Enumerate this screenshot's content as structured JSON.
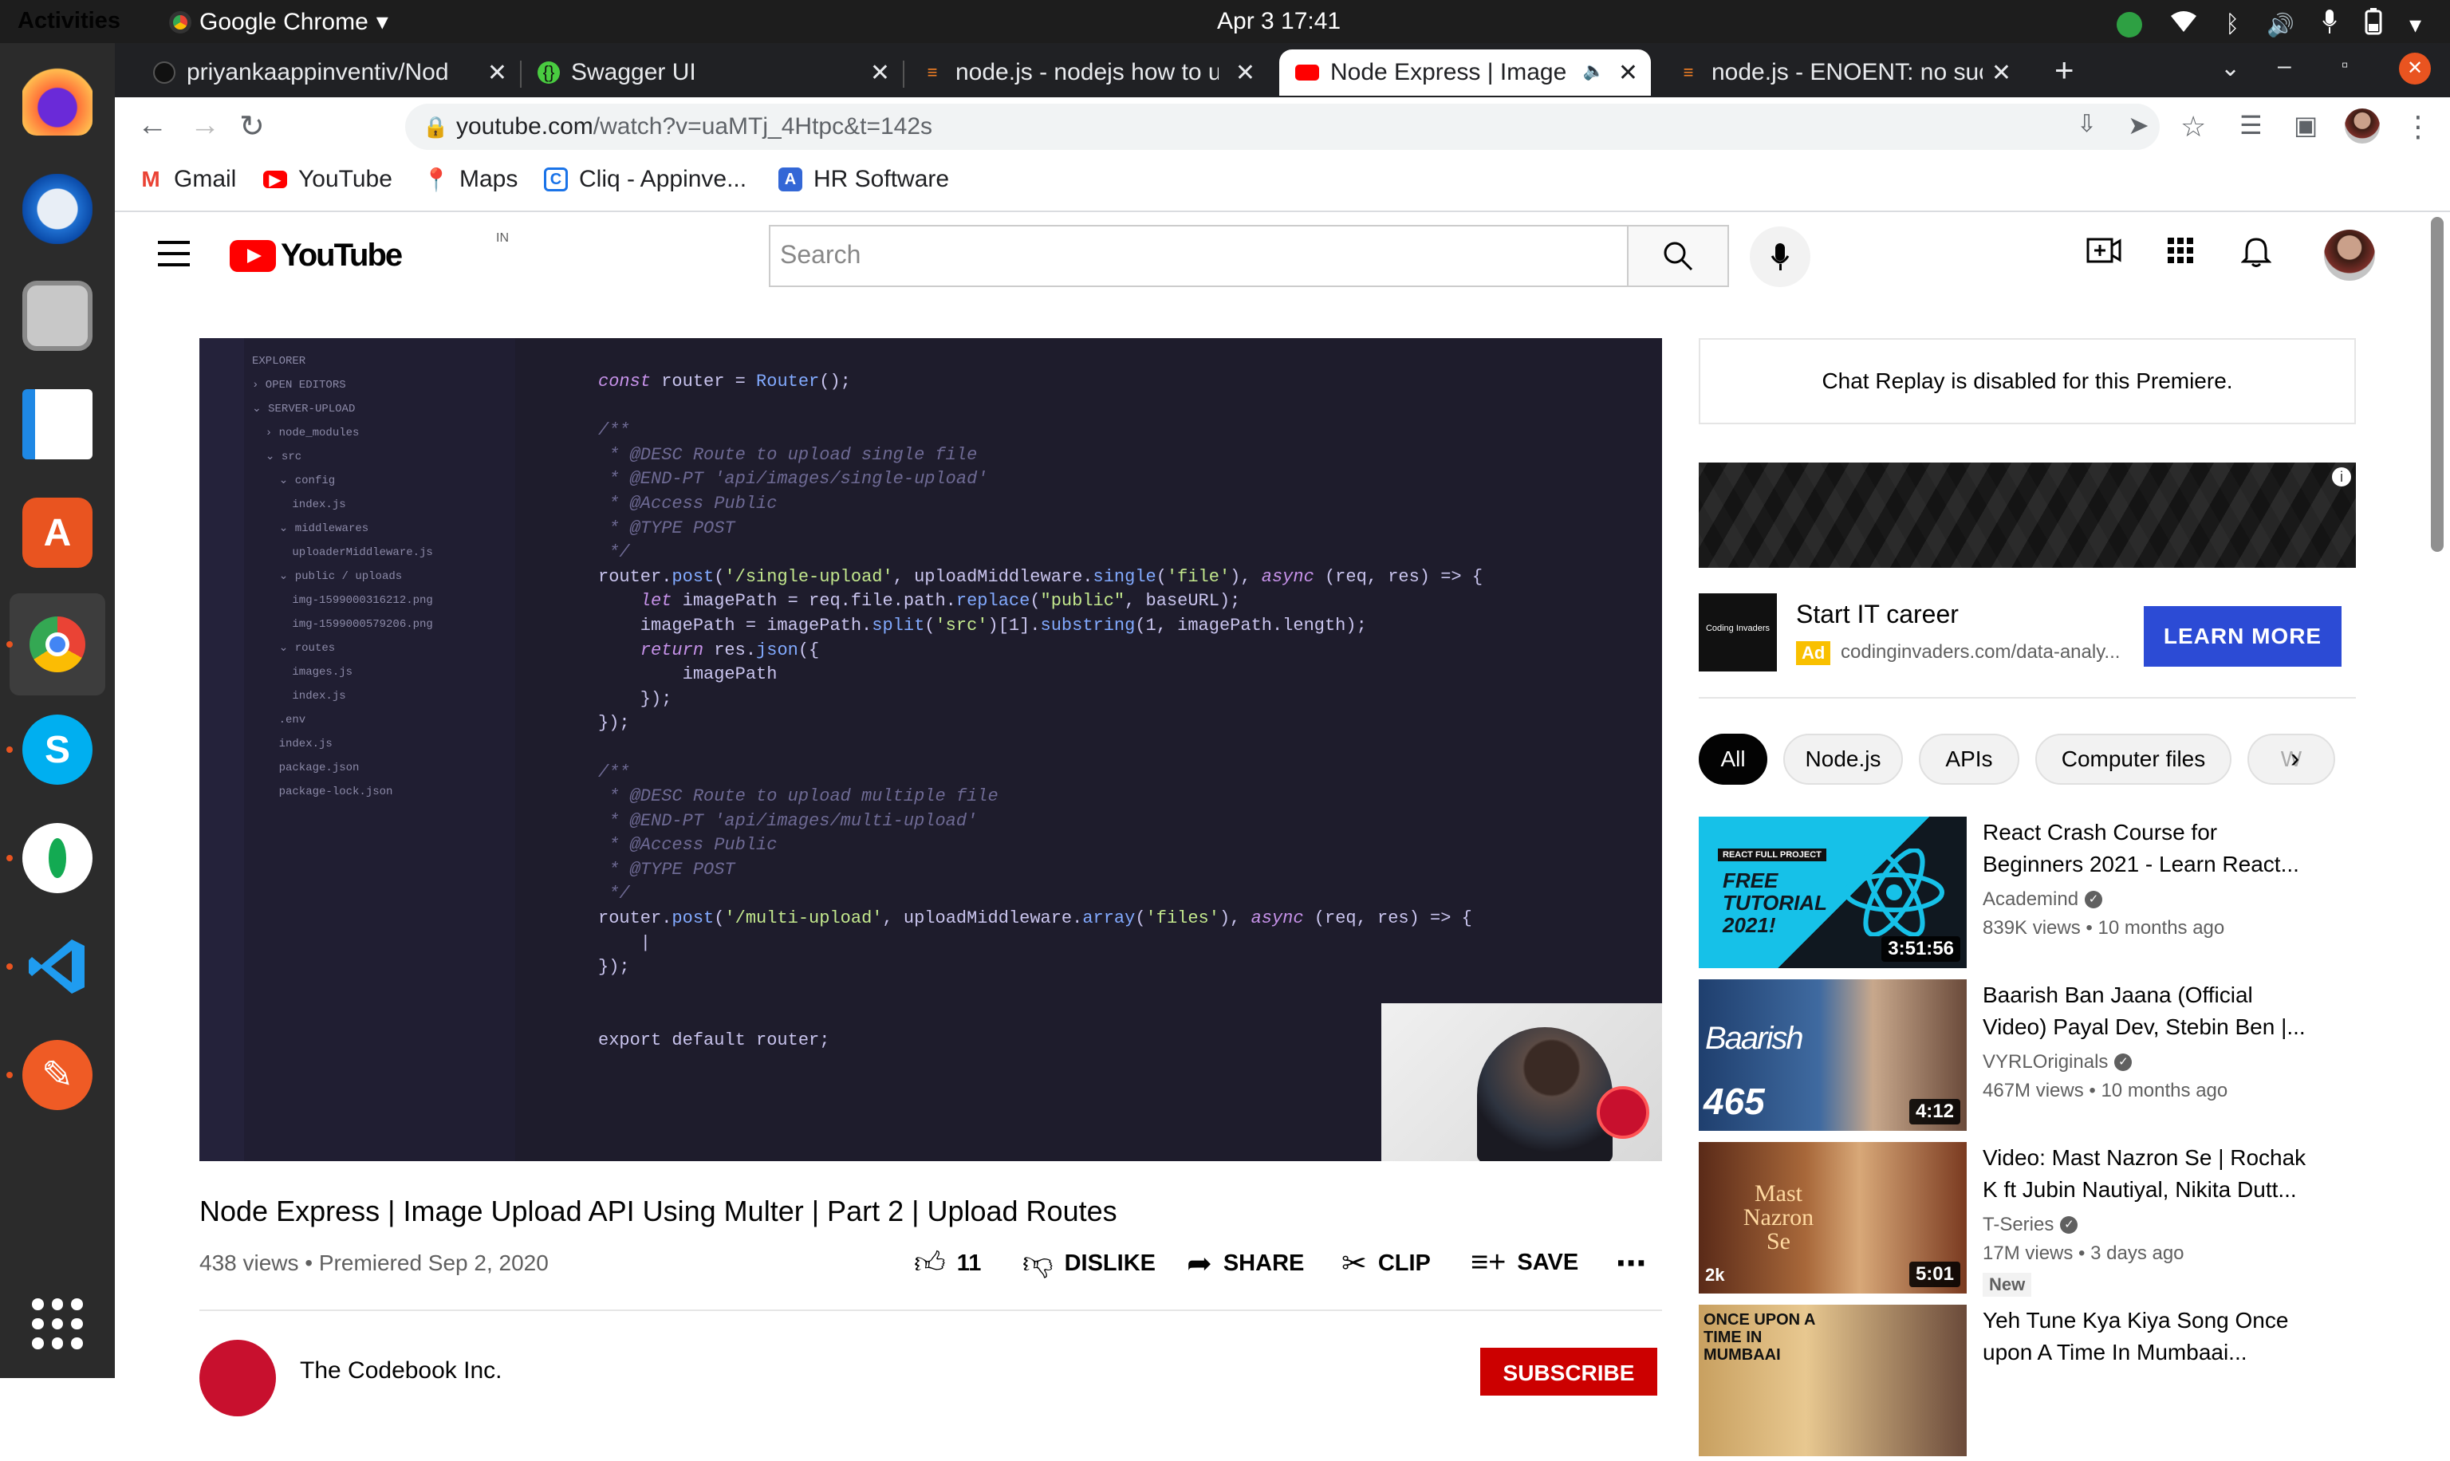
{
  "os": {
    "activities": "Activities",
    "app_name": "Google Chrome",
    "clock": "Apr 3  17:41"
  },
  "tabs": [
    {
      "title": "priyankaappinventiv/Nod",
      "icon": "github-icon"
    },
    {
      "title": "Swagger UI",
      "icon": "swagger-icon"
    },
    {
      "title": "node.js - nodejs how to up",
      "icon": "stackoverflow-icon"
    },
    {
      "title": "Node Express | Image",
      "icon": "youtube-icon",
      "active": true
    },
    {
      "title": "node.js - ENOENT: no such",
      "icon": "stackoverflow-icon"
    }
  ],
  "address": {
    "url_main": "youtube.com",
    "url_rest": "/watch?v=uaMTj_4Htpc&t=142s"
  },
  "bookmarks": [
    {
      "label": "Gmail",
      "icon": "gmail-icon",
      "color": "#ea4335"
    },
    {
      "label": "YouTube",
      "icon": "youtube-icon",
      "color": "#ff0000"
    },
    {
      "label": "Maps",
      "icon": "maps-icon",
      "color": "#34a853"
    },
    {
      "label": "Cliq - Appinve...",
      "icon": "cliq-icon",
      "color": "#1a73e8"
    },
    {
      "label": "HR Software",
      "icon": "hr-software-icon",
      "color": "#3367d6"
    }
  ],
  "youtube": {
    "country": "IN",
    "search_placeholder": "Search"
  },
  "video": {
    "title": "Node Express | Image Upload API Using Multer | Part 2 | Upload Routes",
    "meta": "438 views • Premiered Sep 2, 2020",
    "likes": "11",
    "dislike": "DISLIKE",
    "share": "SHARE",
    "clip": "CLIP",
    "save": "SAVE"
  },
  "channel": {
    "name": "The Codebook Inc.",
    "subscribe": "SUBSCRIBE"
  },
  "chat": "Chat Replay is disabled for this Premiere.",
  "ad": {
    "headline": "Start IT career",
    "badge": "Ad",
    "domain": "codinginvaders.com/data-analy...",
    "cta": "LEARN MORE",
    "logo_text": "Coding Invaders"
  },
  "chips": [
    "All",
    "Node.js",
    "APIs",
    "Computer files",
    "W"
  ],
  "related": [
    {
      "title": "React Crash Course for Beginners 2021 - Learn React...",
      "channel": "Academind",
      "verified": true,
      "stats": "839K views • 10 months ago",
      "duration": "3:51:56",
      "new": ""
    },
    {
      "title": "Baarish Ban Jaana (Official Video) Payal Dev, Stebin Ben |...",
      "channel": "VYRLOriginals",
      "verified": true,
      "stats": "467M views • 10 months ago",
      "duration": "4:12",
      "new": ""
    },
    {
      "title": "Video: Mast Nazron Se | Rochak K ft Jubin Nautiyal, Nikita Dutt...",
      "channel": "T-Series",
      "verified": true,
      "stats": "17M views • 3 days ago",
      "duration": "5:01",
      "new": "New"
    },
    {
      "title": "Yeh Tune Kya Kiya Song Once upon A Time In Mumbaai...",
      "channel": "",
      "verified": false,
      "stats": "",
      "duration": "",
      "new": ""
    }
  ],
  "thumb_text": {
    "react_banner": "REACT FULL PROJECT",
    "react_free": "FREE TUTORIAL 2021!",
    "baarish": "Baarish",
    "baarish_count": "465",
    "mast": "Mast Nazron Se",
    "mast_badge": "2k",
    "mumbaai": "ONCE UPON A TIME IN MUMBAAI"
  }
}
